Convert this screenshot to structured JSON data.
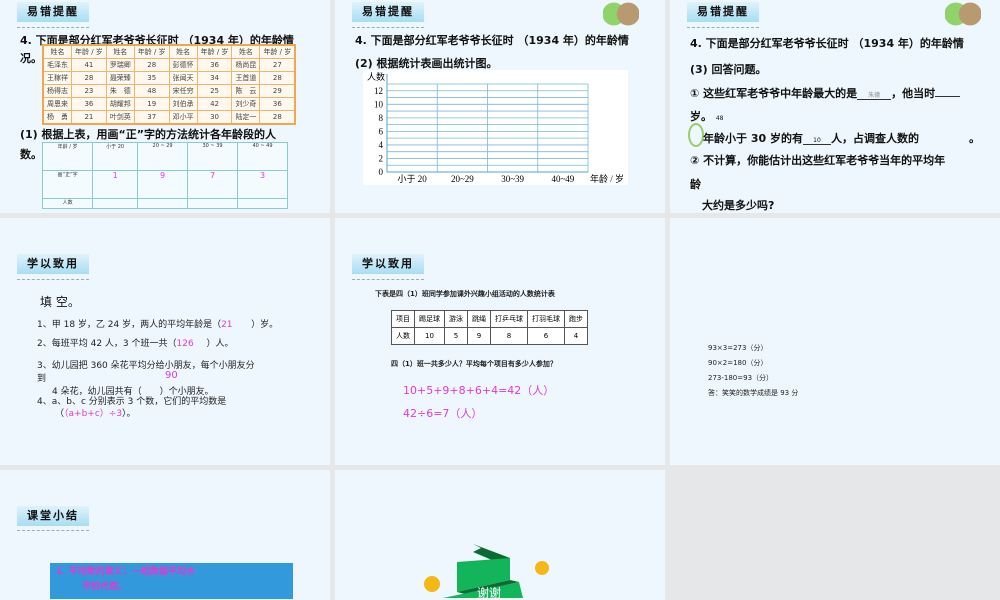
{
  "slides": [
    {
      "badge": "易错提醒",
      "q": "4. 下面是部分红军老爷爷长征时 （1934 年）的年龄情",
      "q2": "况。",
      "table": {
        "headers": [
          "姓名",
          "年龄 / 岁",
          "姓名",
          "年龄 / 岁",
          "姓名",
          "年龄 / 岁",
          "姓名",
          "年龄 / 岁"
        ],
        "rows": [
          [
            "毛泽东",
            "41",
            "罗瑞卿",
            "28",
            "彭德怀",
            "36",
            "杨尚昆",
            "27"
          ],
          [
            "王稼祥",
            "28",
            "聂荣臻",
            "35",
            "张闻天",
            "34",
            "王首道",
            "28"
          ],
          [
            "杨得志",
            "23",
            "朱　德",
            "48",
            "宋任穷",
            "25",
            "陈　云",
            "29"
          ],
          [
            "周恩来",
            "36",
            "胡耀邦",
            "19",
            "刘伯承",
            "42",
            "刘少奇",
            "36"
          ],
          [
            "杨　勇",
            "21",
            "叶剑英",
            "37",
            "邓小平",
            "30",
            "陆定一",
            "28"
          ]
        ]
      },
      "p1": "(1) 根据上表，用画“正”字的方法统计各年龄段的人",
      "p1b": "数。",
      "tally": {
        "headers": [
          "年龄 / 岁",
          "小于 20",
          "20 ~ 29",
          "30 ~ 39",
          "40 ~ 49"
        ],
        "row1_label": "画“正”字",
        "row1": [
          "1",
          "9",
          "7",
          "3"
        ],
        "row2_label": "人数"
      }
    },
    {
      "badge": "易错提醒",
      "q": "4. 下面是部分红军老爷爷长征时 （1934 年）的年龄情",
      "q2": "(2) 根据统计表画出统计图。"
    },
    {
      "badge": "易错提醒",
      "q": "4. 下面是部分红军老爷爷长征时 （1934 年）的年龄情",
      "q2": "(3) 回答问题。",
      "l1": "① 这些红军老爷爷中年龄最大的是",
      "a1": "朱德",
      "l1b": "，他当时",
      "l2": "岁。",
      "a2": "48",
      "l3": "年龄小于 30 岁的有",
      "a3": "10",
      "l3b": "人，占调查人数的",
      "l3c": "。",
      "l4": "② 不计算，你能估计出这些红军老爷爷当年的平均年",
      "l5": "龄",
      "l6": "大约是多少吗?"
    },
    {
      "badge": "学以致用",
      "title": "填 空。",
      "items": [
        "1、甲 18 岁，乙 24 岁，两人的平均年龄是（",
        "2、每班平均 42 人，3 个班一共（",
        "3、幼儿园把 360 朵花平均分给小朋友，每个小朋友分",
        "到",
        "4 朵花，幼儿园共有（　　）个小朋友。",
        "4、a、b、c 分别表示 3 个数，它们的平均数是",
        "（",
        "）。"
      ],
      "ans": [
        "21",
        "126",
        "90",
        "（a+b+c）÷3"
      ],
      "tail": [
        "）岁。",
        "）人。"
      ]
    },
    {
      "badge": "学以致用",
      "caption": "下表是四（1）班同学参加课外兴趣小组活动的人数统计表",
      "table": {
        "headers": [
          "项目",
          "踢足球",
          "游泳",
          "跳绳",
          "打乒乓球",
          "打羽毛球",
          "跑步"
        ],
        "row": [
          "人数",
          "10",
          "5",
          "9",
          "8",
          "6",
          "4"
        ]
      },
      "question": "四（1）班一共多少人？平均每个项目有多少人参加？",
      "a1": "10+5+9+8+6+4=42（人）",
      "a2": "42÷6=7（人）"
    },
    {
      "lines": [
        "93×3=273（分）",
        "90×2=180（分）",
        "273-180=93（分）",
        "答：笑笑的数学成绩是 93 分"
      ]
    },
    {
      "badge": "课堂小结",
      "box": "1. 平均数的意义：一组数据平均水",
      "box2": "平的代表。"
    },
    {
      "ribbon": "谢谢"
    }
  ],
  "chart_data": {
    "type": "bar",
    "title": "",
    "xlabel": "年龄 / 岁",
    "ylabel": "人数",
    "categories": [
      "小于 20",
      "20~29",
      "30~39",
      "40~49"
    ],
    "values": [],
    "ylim": [
      0,
      13
    ],
    "yticks": [
      "0",
      "2",
      "4",
      "6",
      "8",
      "10",
      "12"
    ],
    "grid": true
  }
}
